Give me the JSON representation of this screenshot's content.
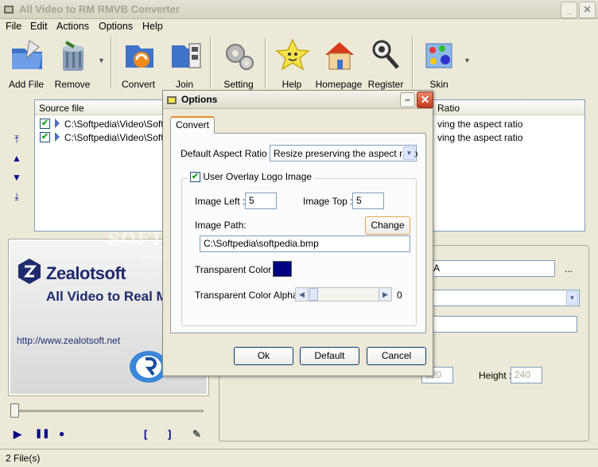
{
  "window": {
    "title": "All Video to RM RMVB Converter",
    "min_label": "_",
    "max_label": "□",
    "close_label": "✕"
  },
  "menu": {
    "file": "File",
    "edit": "Edit",
    "actions": "Actions",
    "options": "Options",
    "help": "Help"
  },
  "toolbar": {
    "add_file": "Add File",
    "remove": "Remove",
    "convert": "Convert",
    "join": "Join",
    "setting": "Setting",
    "help": "Help",
    "homepage": "Homepage",
    "register": "Register",
    "skin": "Skin"
  },
  "file_list": {
    "header_source": "Source file",
    "header_ratio": "Ratio",
    "rows": [
      {
        "path": "C:\\Softpedia\\Video\\Softp",
        "ratio": "ving the aspect ratio"
      },
      {
        "path": "C:\\Softpedia\\Video\\Softp",
        "ratio": "ving the aspect ratio"
      }
    ]
  },
  "preview": {
    "brand": "Zealotsoft",
    "subtitle": "All Video to Real Me",
    "url": "http://www.zealotsoft.net"
  },
  "player": {
    "play": "▶",
    "pause": "❚❚",
    "stop": "●",
    "mark_in": "[",
    "mark_out": "]",
    "clip": "✎"
  },
  "right_panel": {
    "browse": "...",
    "height_label": "Height :",
    "height_value": "240",
    "width_value": "320"
  },
  "status": {
    "text": "2 File(s)"
  },
  "watermark": {
    "main": "SOFTPEDIA",
    "sub": "www.softpedia.com"
  },
  "options_dialog": {
    "title": "Options",
    "tab_convert": "Convert",
    "aspect_label": "Default Aspect Ratio :",
    "aspect_value": "Resize preserving the aspect ratio",
    "overlay_label": "User Overlay Logo Image",
    "image_left_label": "Image Left :",
    "image_left_value": "5",
    "image_top_label": "Image Top :",
    "image_top_value": "5",
    "image_path_label": "Image Path:",
    "change_button": "Change",
    "image_path_value": "C:\\Softpedia\\softpedia.bmp",
    "transparent_color_label": "Transparent Color :",
    "transparent_color": "#000080",
    "alpha_label": "Transparent Color Alpha :",
    "alpha_value": "0",
    "ok_button": "Ok",
    "default_button": "Default",
    "cancel_button": "Cancel"
  }
}
